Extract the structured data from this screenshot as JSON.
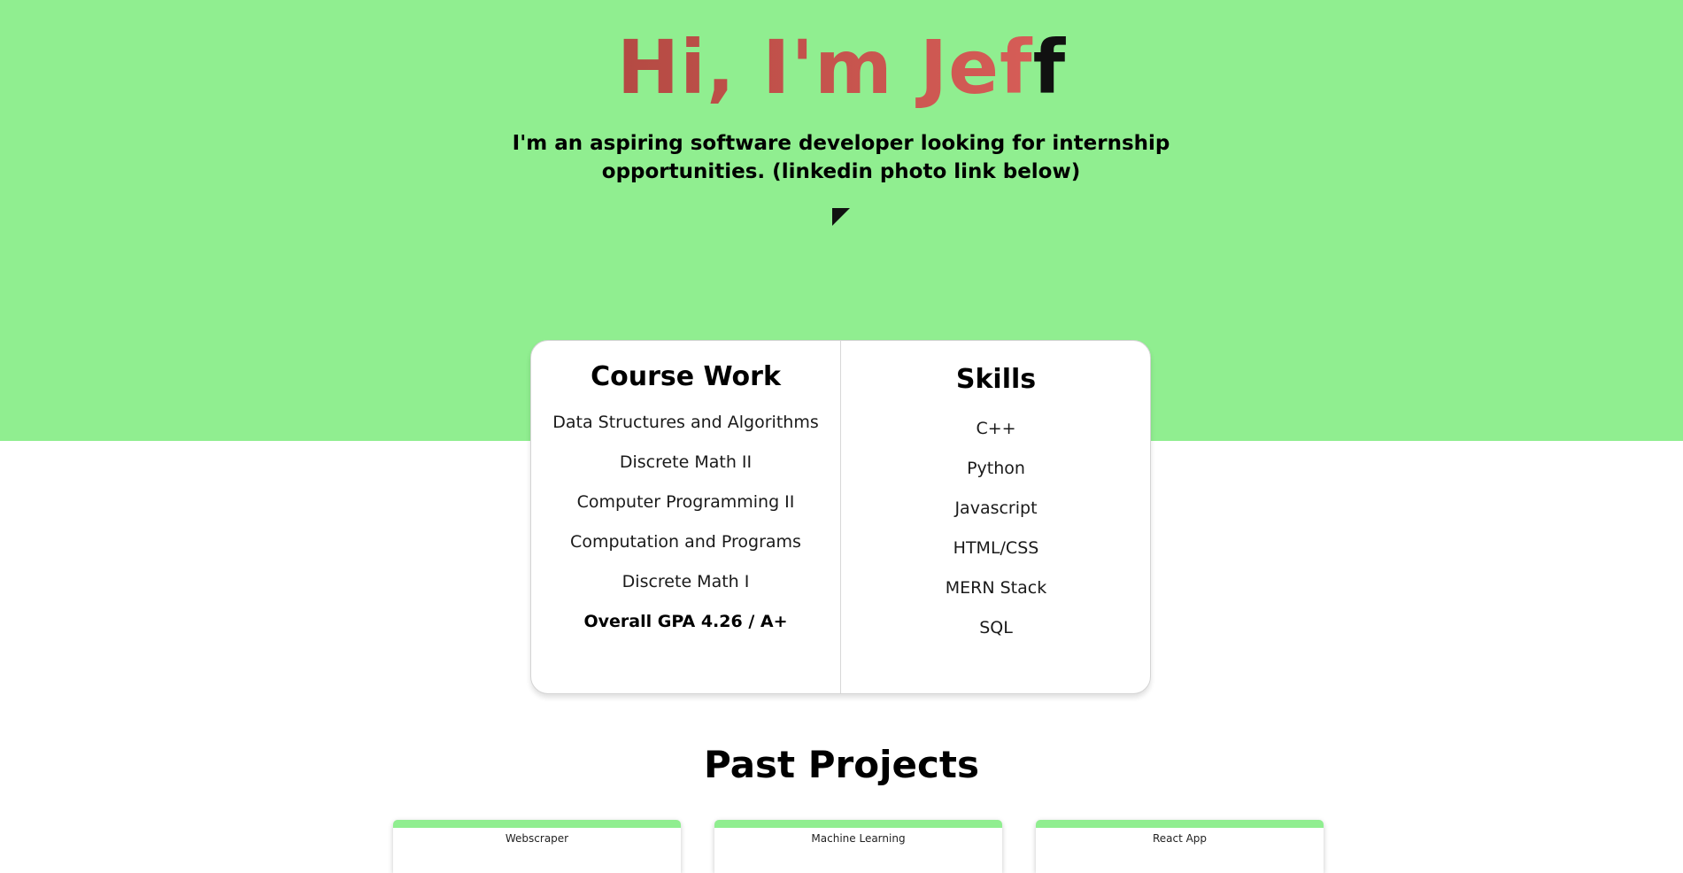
{
  "hero": {
    "title_typed": "Hi, I'm Jef",
    "title_pending": "f",
    "subtitle": "I'm an aspiring software developer looking for internship opportunities. (linkedin photo link below)",
    "background_color": "#90ee90",
    "title_color": "#c9524a",
    "photo_icon": "broken-image-icon"
  },
  "coursework": {
    "title": "Course Work",
    "items": [
      "Data Structures and Algorithms",
      "Discrete Math II",
      "Computer Programming II",
      "Computation and Programs",
      "Discrete Math I"
    ],
    "gpa": "Overall GPA 4.26 / A+"
  },
  "skills": {
    "title": "Skills",
    "items": [
      "C++",
      "Python",
      "Javascript",
      "HTML/CSS",
      "MERN Stack",
      "SQL"
    ]
  },
  "projects": {
    "title": "Past Projects",
    "items": [
      {
        "label": "Webscraper"
      },
      {
        "label": "Machine Learning"
      },
      {
        "label": "React App"
      }
    ],
    "accent_color": "#90ee90"
  }
}
